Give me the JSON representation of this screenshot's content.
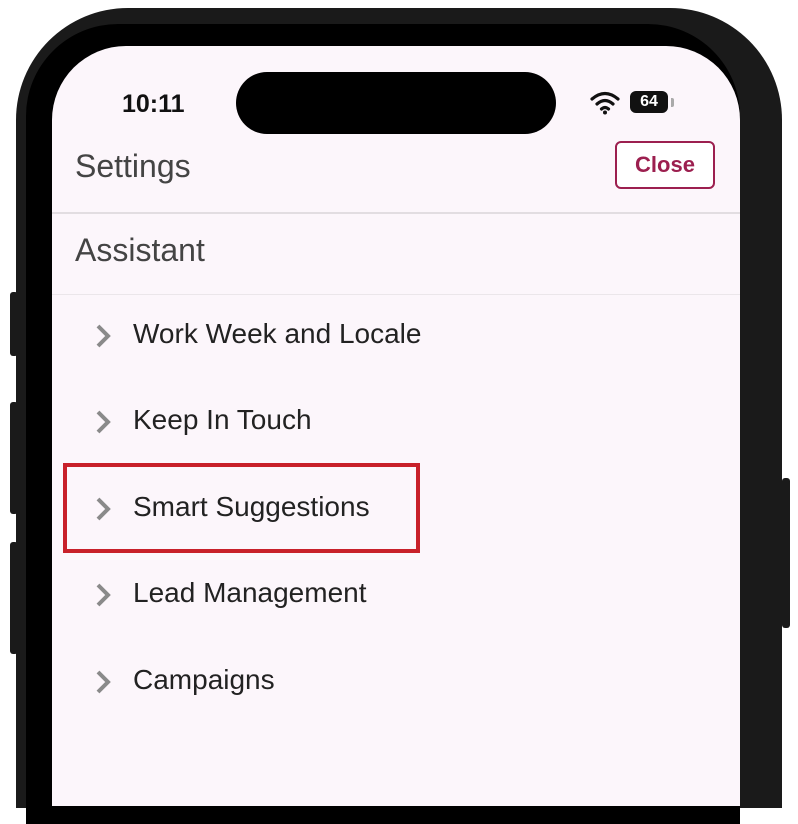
{
  "status_bar": {
    "time": "10:11",
    "battery_level": "64",
    "wifi_icon": "wifi-icon",
    "battery_icon": "battery-icon"
  },
  "header": {
    "title": "Settings",
    "close_label": "Close"
  },
  "section": {
    "title": "Assistant"
  },
  "menu": {
    "items": [
      {
        "label": "Work Week and Locale",
        "icon": "chevron-right-icon"
      },
      {
        "label": "Keep In Touch",
        "icon": "chevron-right-icon"
      },
      {
        "label": "Smart Suggestions",
        "icon": "chevron-right-icon"
      },
      {
        "label": "Lead Management",
        "icon": "chevron-right-icon"
      },
      {
        "label": "Campaigns",
        "icon": "chevron-right-icon"
      }
    ]
  },
  "colors": {
    "accent": "#9c1f4f",
    "screen_background": "#fcf6fb",
    "highlight": "#c8202a"
  }
}
